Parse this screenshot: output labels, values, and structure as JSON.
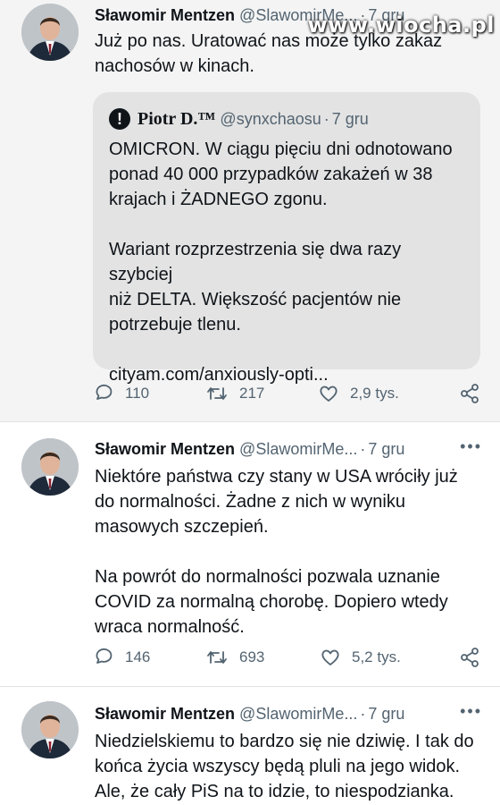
{
  "watermark": "www.wiocha.pl",
  "tweets": [
    {
      "author": "Sławomir Mentzen",
      "handle": "@SlawomirMe...",
      "time": "7 gru",
      "text": "Już po nas. Uratować nas może tylko zakaz\nnachosów w kinach.",
      "quote": {
        "author": "Piotr D.™",
        "handle": "@synxchaosu",
        "time": "7 gru",
        "text": "OMICRON. W ciągu pięciu dni odnotowano\nponad 40 000 przypadków zakażeń w 38\nkrajach i ŻADNEGO zgonu.\n\nWariant rozprzestrzenia się dwa razy szybciej\nniż DELTA. Większość pacjentów nie\npotrzebuje tlenu.\n\ncityam.com/anxiously-opti..."
      },
      "replies": "110",
      "retweets": "217",
      "likes": "2,9 tys."
    },
    {
      "author": "Sławomir Mentzen",
      "handle": "@SlawomirMe...",
      "time": "7 gru",
      "text": "Niektóre państwa czy stany w USA wróciły już\ndo normalności. Żadne z nich w wyniku\nmasowych szczepień.\n\nNa powrót do normalności pozwala uznanie\nCOVID za normalną chorobę. Dopiero wtedy\nwraca normalność.",
      "replies": "146",
      "retweets": "693",
      "likes": "5,2 tys."
    },
    {
      "author": "Sławomir Mentzen",
      "handle": "@SlawomirMe...",
      "time": "7 gru",
      "text": "Niedzielskiemu to bardzo się nie dziwię. I tak do\nkońca życia wszyscy będą pluli na jego widok.\nAle, że cały PiS na to idzie, to niespodzianka."
    }
  ],
  "icons": {
    "reply": "reply-icon",
    "retweet": "retweet-icon",
    "like": "heart-icon",
    "share": "share-icon",
    "more": "more-icon",
    "quote_avatar": "exclamation-icon"
  }
}
